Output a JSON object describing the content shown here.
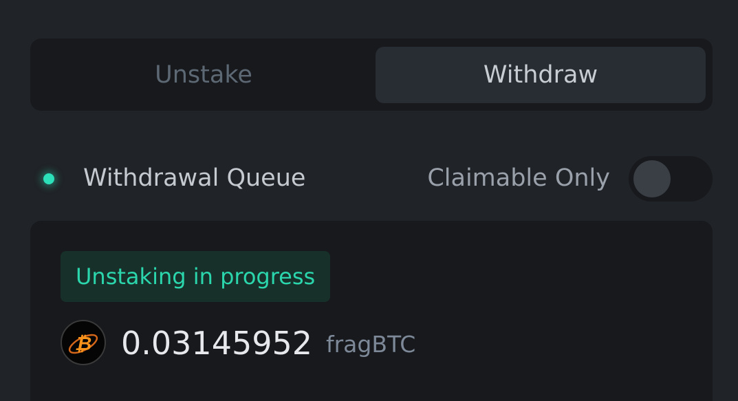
{
  "tabs": [
    {
      "label": "Unstake",
      "active": false
    },
    {
      "label": "Withdraw",
      "active": true
    }
  ],
  "queue": {
    "title": "Withdrawal Queue",
    "filter_label": "Claimable Only",
    "filter_enabled": false
  },
  "item": {
    "status": "Unstaking in progress",
    "amount": "0.03145952",
    "token": "fragBTC",
    "token_icon": "bitcoin-icon"
  },
  "colors": {
    "accent": "#2ce0b9",
    "status_bg": "#17312a",
    "bitcoin_orange": "#f7931a"
  }
}
